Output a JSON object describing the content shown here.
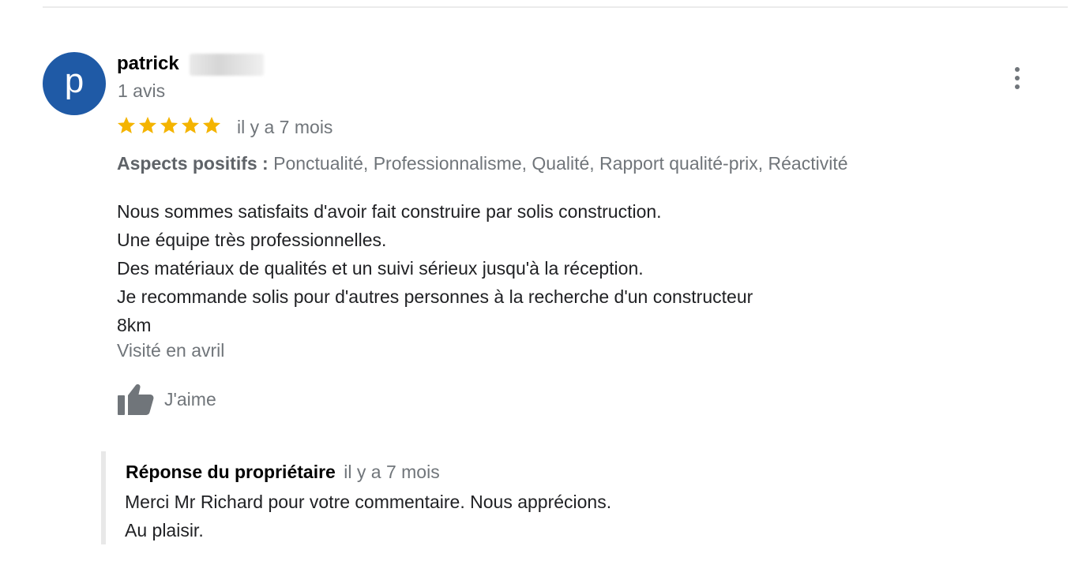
{
  "review": {
    "avatar_letter": "p",
    "author_name": "patrick",
    "review_count": "1 avis",
    "rating": 5,
    "rating_max": 5,
    "time_ago": "il y a 7 mois",
    "aspects_label": "Aspects positifs :",
    "aspects_values": "Ponctualité, Professionnalisme, Qualité, Rapport qualité-prix, Réactivité",
    "body_lines": [
      "Nous sommes satisfaits d'avoir fait construire par solis construction.",
      "Une équipe très professionnelles.",
      "Des matériaux de qualités et un suivi sérieux jusqu'à la réception.",
      "Je recommande solis pour d'autres personnes à la recherche d'un constructeur",
      "8km"
    ],
    "visited": "Visité en avril",
    "like_label": "J'aime",
    "star_icon": "star-icon",
    "like_icon": "thumbs-up-icon",
    "more_icon": "more-vert-icon"
  },
  "owner_reply": {
    "title": "Réponse du propriétaire",
    "time_ago": "il y a 7 mois",
    "lines": [
      "Merci Mr Richard pour votre commentaire. Nous apprécions.",
      "Au plaisir."
    ]
  },
  "colors": {
    "avatar_bg": "#1f5aa6",
    "star": "#f4b400",
    "secondary_text": "#70757a",
    "divider": "#ebebeb"
  }
}
